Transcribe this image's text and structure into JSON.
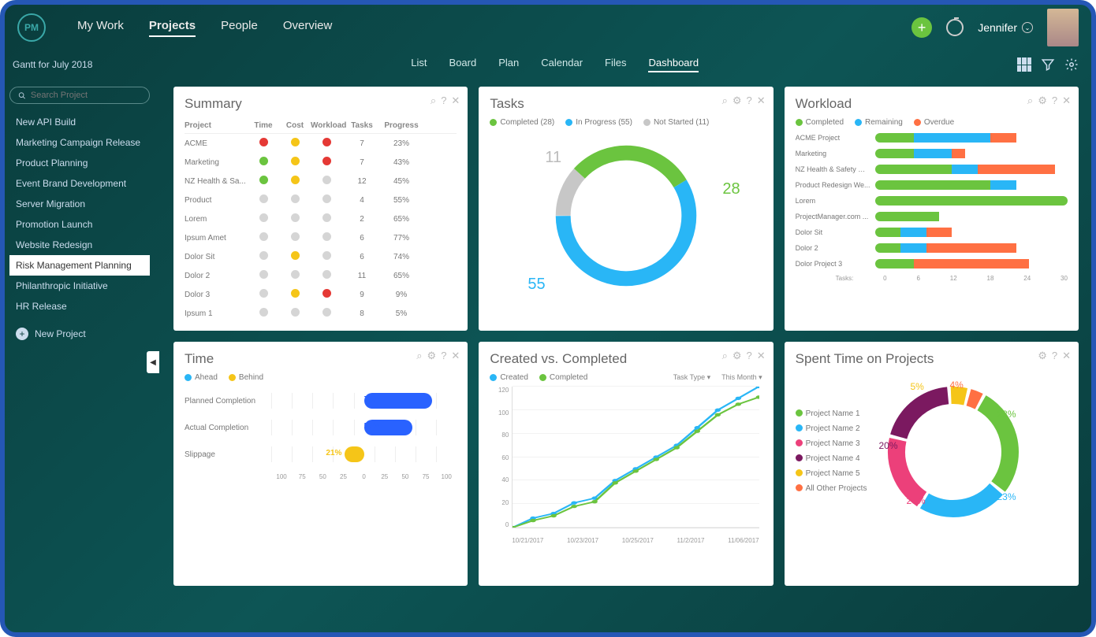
{
  "logo": "PM",
  "nav": [
    "My Work",
    "Projects",
    "People",
    "Overview"
  ],
  "nav_active": 1,
  "user_name": "Jennifer",
  "sub_left": "Gantt for July 2018",
  "subnav": [
    "List",
    "Board",
    "Plan",
    "Calendar",
    "Files",
    "Dashboard"
  ],
  "subnav_active": 5,
  "search_placeholder": "Search Project",
  "sidebar_projects": [
    "New API Build",
    "Marketing Campaign Release",
    "Product Planning",
    "Event Brand Development",
    "Server Migration",
    "Promotion Launch",
    "Website Redesign",
    "Risk Management Planning",
    "Philanthropic Initiative",
    "HR Release"
  ],
  "sidebar_selected": 7,
  "new_project_label": "New Project",
  "cards": {
    "summary": {
      "title": "Summary",
      "headers": [
        "Project",
        "Time",
        "Cost",
        "Workload",
        "Tasks",
        "Progress"
      ]
    },
    "tasks": {
      "title": "Tasks",
      "legend": [
        {
          "c": "green",
          "t": "Completed (28)"
        },
        {
          "c": "blue",
          "t": "In Progress (55)"
        },
        {
          "c": "grey",
          "t": "Not Started (11)"
        }
      ]
    },
    "workload": {
      "title": "Workload",
      "legend": [
        {
          "c": "green",
          "t": "Completed"
        },
        {
          "c": "blue",
          "t": "Remaining"
        },
        {
          "c": "orange",
          "t": "Overdue"
        }
      ],
      "axis_label": "Tasks:"
    },
    "time": {
      "title": "Time",
      "legend": [
        {
          "c": "blue",
          "t": "Ahead"
        },
        {
          "c": "yellow",
          "t": "Behind"
        }
      ]
    },
    "cvc": {
      "title": "Created vs. Completed",
      "legend": [
        {
          "c": "blue",
          "t": "Created"
        },
        {
          "c": "green",
          "t": "Completed"
        }
      ],
      "filter1": "Task Type ▾",
      "filter2": "This Month ▾"
    },
    "spent": {
      "title": "Spent Time on Projects"
    }
  },
  "chart_data": [
    {
      "type": "table",
      "title": "Summary",
      "columns": [
        "Project",
        "Time",
        "Cost",
        "Workload",
        "Tasks",
        "Progress"
      ],
      "rows": [
        {
          "project": "ACME",
          "time": "red",
          "cost": "yellow",
          "workload": "red",
          "tasks": 7,
          "progress": "23%"
        },
        {
          "project": "Marketing",
          "time": "green",
          "cost": "yellow",
          "workload": "red",
          "tasks": 7,
          "progress": "43%"
        },
        {
          "project": "NZ Health & Sa...",
          "time": "green",
          "cost": "yellow",
          "workload": "grey",
          "tasks": 12,
          "progress": "45%"
        },
        {
          "project": "Product",
          "time": "grey",
          "cost": "grey",
          "workload": "grey",
          "tasks": 4,
          "progress": "55%"
        },
        {
          "project": "Lorem",
          "time": "grey",
          "cost": "grey",
          "workload": "grey",
          "tasks": 2,
          "progress": "65%"
        },
        {
          "project": "Ipsum Amet",
          "time": "grey",
          "cost": "grey",
          "workload": "grey",
          "tasks": 6,
          "progress": "77%"
        },
        {
          "project": "Dolor Sit",
          "time": "grey",
          "cost": "yellow",
          "workload": "grey",
          "tasks": 6,
          "progress": "74%"
        },
        {
          "project": "Dolor 2",
          "time": "grey",
          "cost": "grey",
          "workload": "grey",
          "tasks": 11,
          "progress": "65%"
        },
        {
          "project": "Dolor 3",
          "time": "grey",
          "cost": "yellow",
          "workload": "red",
          "tasks": 9,
          "progress": "9%"
        },
        {
          "project": "Ipsum 1",
          "time": "grey",
          "cost": "grey",
          "workload": "grey",
          "tasks": 8,
          "progress": "5%"
        }
      ]
    },
    {
      "type": "pie",
      "title": "Tasks",
      "series": [
        {
          "name": "Completed",
          "value": 28,
          "color": "#6bc43f"
        },
        {
          "name": "In Progress",
          "value": 55,
          "color": "#29b6f6"
        },
        {
          "name": "Not Started",
          "value": 11,
          "color": "#c7c7c7"
        }
      ],
      "labels": [
        "28",
        "55",
        "11"
      ]
    },
    {
      "type": "bar",
      "title": "Workload",
      "orientation": "horizontal",
      "stacked": true,
      "categories": [
        "ACME Project",
        "Marketing",
        "NZ Health & Safety De...",
        "Product Redesign We...",
        "Lorem",
        "ProjectManager.com ...",
        "Dolor Sit",
        "Dolor 2",
        "Dolor Project 3"
      ],
      "series": [
        {
          "name": "Completed",
          "color": "#6bc43f",
          "values": [
            6,
            6,
            12,
            18,
            30,
            10,
            4,
            4,
            6
          ]
        },
        {
          "name": "Remaining",
          "color": "#29b6f6",
          "values": [
            12,
            6,
            4,
            4,
            0,
            0,
            4,
            4,
            0
          ]
        },
        {
          "name": "Overdue",
          "color": "#ff7043",
          "values": [
            4,
            2,
            12,
            0,
            0,
            0,
            4,
            14,
            18
          ]
        }
      ],
      "xlabel": "Tasks:",
      "xticks": [
        0,
        6,
        12,
        18,
        24,
        30
      ]
    },
    {
      "type": "bar",
      "title": "Time",
      "orientation": "horizontal",
      "categories": [
        "Planned Completion",
        "Actual Completion",
        "Slippage"
      ],
      "values": [
        73,
        52,
        -21
      ],
      "colors": [
        "#2962ff",
        "#2962ff",
        "#f5c518"
      ],
      "xlim": [
        -100,
        100
      ],
      "xticks": [
        -100,
        -75,
        -50,
        -25,
        0,
        25,
        50,
        75,
        100
      ],
      "value_labels": [
        "73%",
        "52%",
        "21%"
      ]
    },
    {
      "type": "line",
      "title": "Created vs. Completed",
      "x": [
        "10/21/2017",
        "10/23/2017",
        "10/25/2017",
        "11/2/2017",
        "11/06/2017"
      ],
      "series": [
        {
          "name": "Created",
          "color": "#29b6f6",
          "values": [
            0,
            8,
            12,
            21,
            25,
            40,
            50,
            60,
            70,
            85,
            100,
            110,
            120
          ]
        },
        {
          "name": "Completed",
          "color": "#6bc43f",
          "values": [
            0,
            6,
            10,
            18,
            22,
            38,
            48,
            58,
            68,
            82,
            96,
            105,
            111
          ]
        }
      ],
      "ylim": [
        0,
        120
      ],
      "yticks": [
        0,
        20,
        40,
        60,
        80,
        100,
        120
      ]
    },
    {
      "type": "pie",
      "title": "Spent Time on Projects",
      "series": [
        {
          "name": "Project Name 1",
          "value": 28,
          "color": "#6bc43f"
        },
        {
          "name": "Project Name 2",
          "value": 23,
          "color": "#29b6f6"
        },
        {
          "name": "Project Name 3",
          "value": 20,
          "color": "#ec407a"
        },
        {
          "name": "Project Name 4",
          "value": 20,
          "color": "#7b1960"
        },
        {
          "name": "Project Name 5",
          "value": 5,
          "color": "#f5c518"
        },
        {
          "name": "All Other Projects",
          "value": 4,
          "color": "#ff7043"
        }
      ],
      "labels": [
        "28%",
        "23%",
        "20%",
        "20%",
        "5%",
        "4%"
      ]
    }
  ]
}
